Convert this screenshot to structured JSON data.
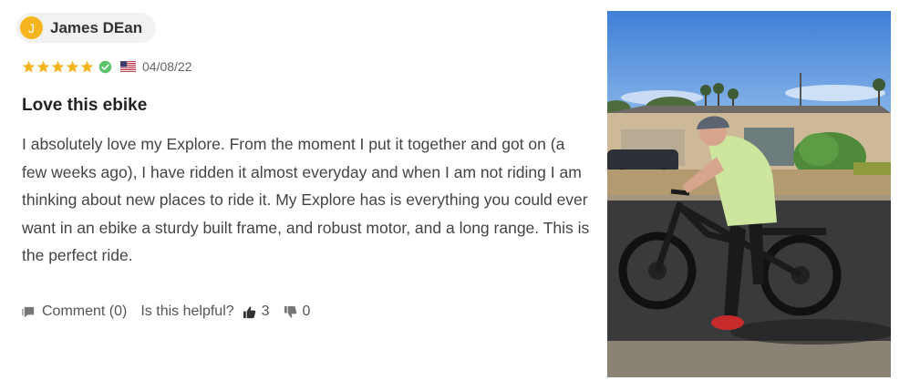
{
  "review": {
    "author": {
      "initial": "J",
      "name": "James DEan"
    },
    "rating": {
      "stars": 5,
      "max": 5
    },
    "verified_icon": "check-circle-icon",
    "country_flag": "us-flag-icon",
    "date": "04/08/22",
    "title": "Love this ebike",
    "body": "I absolutely love my Explore. From the moment I put it together and got on (a few weeks ago), I have ridden it almost everyday and when I am not riding I am thinking about new places to ride it. My Explore has is everything you could ever want in an ebike a sturdy built frame, and robust motor, and a long range. This is the perfect ride.",
    "actions": {
      "comment_icon": "comment-icon",
      "comment_label": "Comment (0)",
      "helpful_label": "Is this helpful?",
      "thumbs_up_icon": "thumbs-up-icon",
      "helpful_yes": "3",
      "thumbs_down_icon": "thumbs-down-icon",
      "helpful_no": "0"
    }
  },
  "colors": {
    "avatar_bg": "#f6b51e",
    "star": "#f6b51e",
    "verified": "#5cc36b",
    "text": "#444444"
  }
}
